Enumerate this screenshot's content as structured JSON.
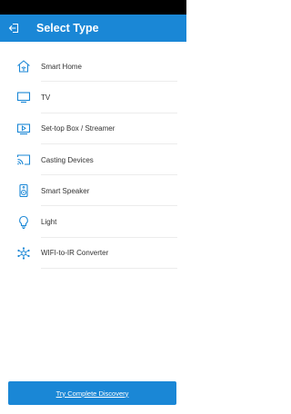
{
  "header": {
    "title": "Select Type",
    "back_icon": "exit-arrow-icon"
  },
  "device_types": [
    {
      "label": "Smart Home",
      "icon": "smart-home-icon"
    },
    {
      "label": "TV",
      "icon": "tv-icon"
    },
    {
      "label": "Set-top Box / Streamer",
      "icon": "set-top-box-icon"
    },
    {
      "label": "Casting Devices",
      "icon": "casting-icon"
    },
    {
      "label": "Smart Speaker",
      "icon": "speaker-icon"
    },
    {
      "label": "Light",
      "icon": "light-bulb-icon"
    },
    {
      "label": "WIFI-to-IR Converter",
      "icon": "wifi-ir-converter-icon"
    }
  ],
  "footer": {
    "discovery_label": "Try Complete Discovery"
  },
  "colors": {
    "primary": "#1a87d6",
    "icon": "#1a87d6",
    "text": "#333333"
  }
}
